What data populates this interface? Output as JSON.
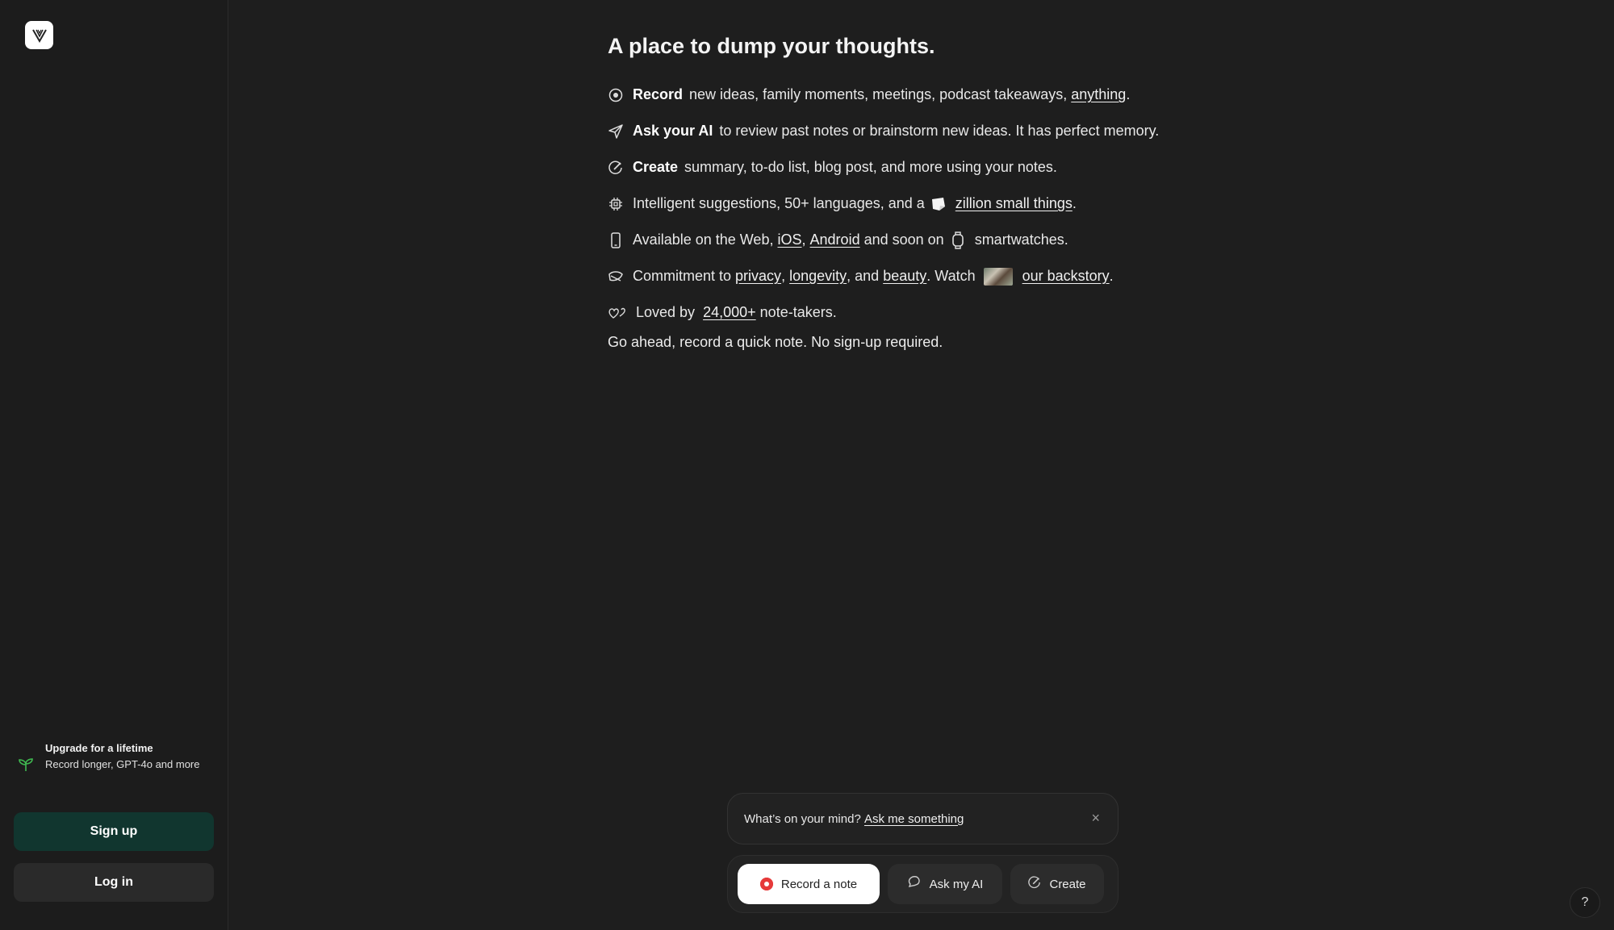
{
  "sidebar": {
    "logo_icon": "voicenotes-logo-icon",
    "upgrade_title": "Upgrade for a lifetime",
    "upgrade_desc": "Record longer, GPT-4o and more",
    "signup_label": "Sign up",
    "login_label": "Log in"
  },
  "main": {
    "headline": "A place to dump your thoughts.",
    "features": {
      "record": {
        "bold": "Record",
        "text": "new ideas, family moments, meetings, podcast takeaways,",
        "link": "anything",
        "end": "."
      },
      "ask": {
        "bold": "Ask your AI",
        "text": "to review past notes or brainstorm new ideas. It has perfect memory."
      },
      "create": {
        "bold": "Create",
        "text": "summary, to-do list, blog post, and more using your notes."
      },
      "intelligent": {
        "text": "Intelligent suggestions, 50+ languages, and a",
        "link": "zillion small things",
        "end": "."
      },
      "available": {
        "text": "Available on the Web,",
        "link_ios": "iOS",
        "comma": ",",
        "link_android": "Android",
        "text2": "and soon on",
        "text3": "smartwatches."
      },
      "commitment": {
        "text": "Commitment to",
        "link_privacy": "privacy",
        "comma": ",",
        "link_longevity": "longevity",
        "and": ", and",
        "link_beauty": "beauty",
        "watch": ". Watch",
        "link_backstory": "our backstory",
        "end": "."
      },
      "loved": {
        "text": "Loved by",
        "link": "24,000+",
        "text2": "note-takers."
      }
    },
    "outro": "Go ahead, record a quick note. No sign-up required."
  },
  "composer": {
    "prompt": "What’s on your mind?",
    "link": "Ask me something",
    "close_glyph": "×"
  },
  "actions": {
    "record": "Record a note",
    "ask": "Ask my AI",
    "create": "Create"
  },
  "help_glyph": "?",
  "colors": {
    "background": "#1e1e1e",
    "signup_bg": "#11362f",
    "record_dot": "#e63a3a",
    "sprout": "#3fb950"
  }
}
